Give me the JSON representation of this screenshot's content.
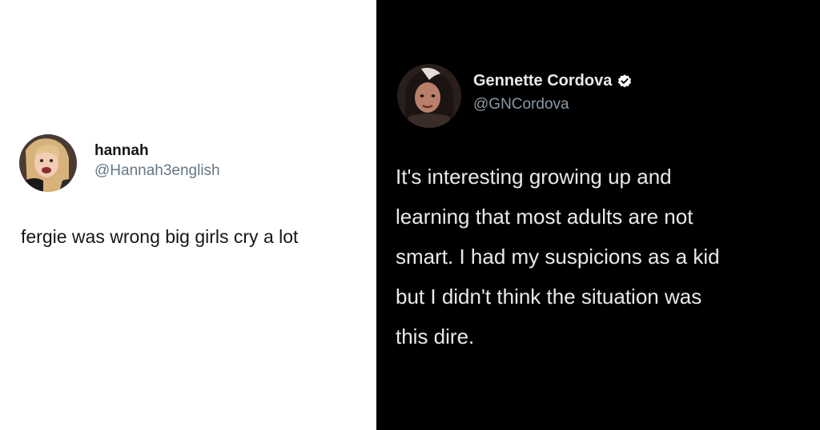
{
  "left_tweet": {
    "display_name": "hannah",
    "handle": "@Hannah3english",
    "text": "fergie was wrong big girls cry a lot"
  },
  "right_tweet": {
    "display_name": "Gennette Cordova",
    "handle": "@GNCordova",
    "verified": true,
    "text_lines": [
      "It's interesting growing up and",
      "learning that most adults are not",
      "smart. I had my suspicions as a kid",
      "but I didn't think the situation was",
      "this dire."
    ]
  },
  "colors": {
    "left_background": "#ffffff",
    "right_background": "#000000",
    "light_name": "#14171a",
    "light_handle": "#657786",
    "dark_text": "#e7e9ea",
    "dark_handle": "#8b98a5",
    "verified_badge": "#ffffff"
  }
}
